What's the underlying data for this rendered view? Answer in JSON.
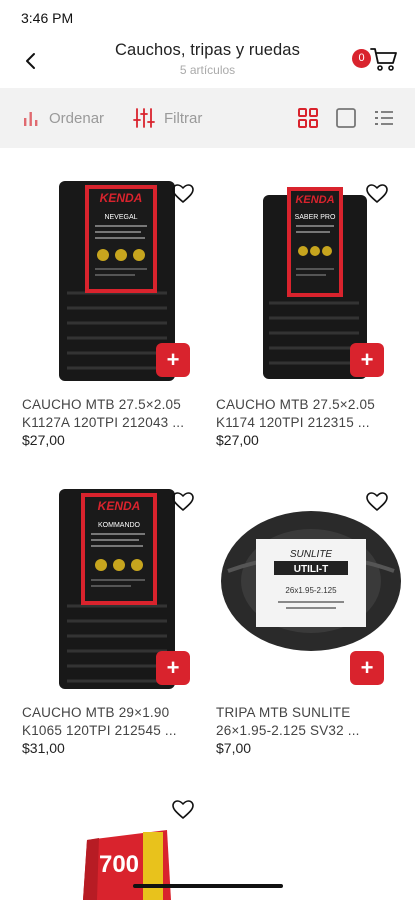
{
  "status_bar": {
    "time": "3:46 PM"
  },
  "header": {
    "title": "Cauchos, tripas y ruedas",
    "subtitle": "5 artículos",
    "cart_count": "0",
    "back_icon": "chevron-left-icon",
    "cart_icon": "shopping-cart-icon"
  },
  "toolbar": {
    "sort_label": "Ordenar",
    "filter_label": "Filtrar",
    "views": [
      "grid-view-icon",
      "single-view-icon",
      "list-view-icon"
    ],
    "active_view": "grid-view-icon"
  },
  "colors": {
    "accent": "#d9232d",
    "toolbar_bg": "#f2f2f2",
    "muted_text": "#9a9a9a"
  },
  "products": [
    {
      "name_line1": "CAUCHO MTB 27.5×2.05",
      "name_line2": "K1127A 120TPI 212043 ...",
      "price": "$27,00",
      "brand": "KENDA",
      "model": "NEVEGAL"
    },
    {
      "name_line1": "CAUCHO MTB 27.5×2.05",
      "name_line2": "K1174 120TPI 212315 ...",
      "price": "$27,00",
      "brand": "KENDA",
      "model": "SABER PRO"
    },
    {
      "name_line1": "CAUCHO MTB 29×1.90",
      "name_line2": "K1065 120TPI 212545 ...",
      "price": "$31,00",
      "brand": "KENDA",
      "model": "KOMMANDO"
    },
    {
      "name_line1": "TRIPA MTB SUNLITE",
      "name_line2": "26×1.95-2.125 SV32 ...",
      "price": "$7,00",
      "brand": "SUNLITE",
      "model": "UTILI-T",
      "size": "26x1.95-2.125"
    },
    {
      "name_line1": "",
      "name_line2": "",
      "price": "",
      "label": "700"
    }
  ]
}
